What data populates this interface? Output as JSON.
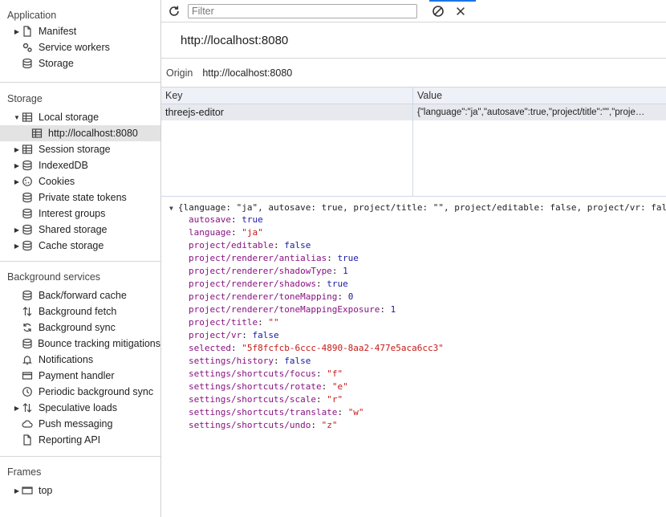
{
  "sidebar": {
    "application": {
      "title": "Application",
      "items": [
        {
          "label": "Manifest",
          "icon": "document-icon"
        },
        {
          "label": "Service workers",
          "icon": "gears-icon"
        },
        {
          "label": "Storage",
          "icon": "database-icon"
        }
      ]
    },
    "storage": {
      "title": "Storage",
      "local_storage": "Local storage",
      "local_storage_child": "http://localhost:8080",
      "items": [
        {
          "label": "Session storage",
          "icon": "table-icon"
        },
        {
          "label": "IndexedDB",
          "icon": "database-icon"
        },
        {
          "label": "Cookies",
          "icon": "cookie-icon"
        },
        {
          "label": "Private state tokens",
          "icon": "database-icon"
        },
        {
          "label": "Interest groups",
          "icon": "database-icon"
        },
        {
          "label": "Shared storage",
          "icon": "database-icon"
        },
        {
          "label": "Cache storage",
          "icon": "database-icon"
        }
      ]
    },
    "background": {
      "title": "Background services",
      "items": [
        {
          "label": "Back/forward cache",
          "icon": "database-icon"
        },
        {
          "label": "Background fetch",
          "icon": "arrows-updown-icon"
        },
        {
          "label": "Background sync",
          "icon": "sync-icon"
        },
        {
          "label": "Bounce tracking mitigations",
          "icon": "database-icon"
        },
        {
          "label": "Notifications",
          "icon": "bell-icon"
        },
        {
          "label": "Payment handler",
          "icon": "card-icon"
        },
        {
          "label": "Periodic background sync",
          "icon": "clock-icon"
        },
        {
          "label": "Speculative loads",
          "icon": "arrows-updown-icon"
        },
        {
          "label": "Push messaging",
          "icon": "cloud-icon"
        },
        {
          "label": "Reporting API",
          "icon": "document-icon"
        }
      ]
    },
    "frames": {
      "title": "Frames",
      "top": "top"
    }
  },
  "toolbar": {
    "filter_placeholder": "Filter",
    "icons": [
      "refresh-icon",
      "clear-icon",
      "close-icon"
    ]
  },
  "main": {
    "url_header": "http://localhost:8080",
    "origin_label": "Origin",
    "origin_value": "http://localhost:8080",
    "table": {
      "columns": [
        "Key",
        "Value"
      ],
      "rows": [
        {
          "key": "threejs-editor",
          "value": "{\"language\":\"ja\",\"autosave\":true,\"project/title\":\"\",\"proje…"
        }
      ]
    },
    "json": {
      "summary": "{language: \"ja\", autosave: true, project/title: \"\", project/editable: false, project/vr: false,…}",
      "entries": [
        {
          "key": "autosave",
          "value": "true",
          "type": "bool"
        },
        {
          "key": "language",
          "value": "\"ja\"",
          "type": "str"
        },
        {
          "key": "project/editable",
          "value": "false",
          "type": "bool"
        },
        {
          "key": "project/renderer/antialias",
          "value": "true",
          "type": "bool"
        },
        {
          "key": "project/renderer/shadowType",
          "value": "1",
          "type": "num"
        },
        {
          "key": "project/renderer/shadows",
          "value": "true",
          "type": "bool"
        },
        {
          "key": "project/renderer/toneMapping",
          "value": "0",
          "type": "num"
        },
        {
          "key": "project/renderer/toneMappingExposure",
          "value": "1",
          "type": "num"
        },
        {
          "key": "project/title",
          "value": "\"\"",
          "type": "str"
        },
        {
          "key": "project/vr",
          "value": "false",
          "type": "bool"
        },
        {
          "key": "selected",
          "value": "\"5f8fcfcb-6ccc-4890-8aa2-477e5aca6cc3\"",
          "type": "str"
        },
        {
          "key": "settings/history",
          "value": "false",
          "type": "bool"
        },
        {
          "key": "settings/shortcuts/focus",
          "value": "\"f\"",
          "type": "str"
        },
        {
          "key": "settings/shortcuts/rotate",
          "value": "\"e\"",
          "type": "str"
        },
        {
          "key": "settings/shortcuts/scale",
          "value": "\"r\"",
          "type": "str"
        },
        {
          "key": "settings/shortcuts/translate",
          "value": "\"w\"",
          "type": "str"
        },
        {
          "key": "settings/shortcuts/undo",
          "value": "\"z\"",
          "type": "str"
        }
      ]
    }
  },
  "colors": {
    "accent": "#1a73e8",
    "json_key": "#881280",
    "json_string": "#c41a16",
    "json_literal": "#1a1aa6",
    "table_header_bg": "#eef1f7",
    "selected_row_bg": "#e7e9ee"
  }
}
